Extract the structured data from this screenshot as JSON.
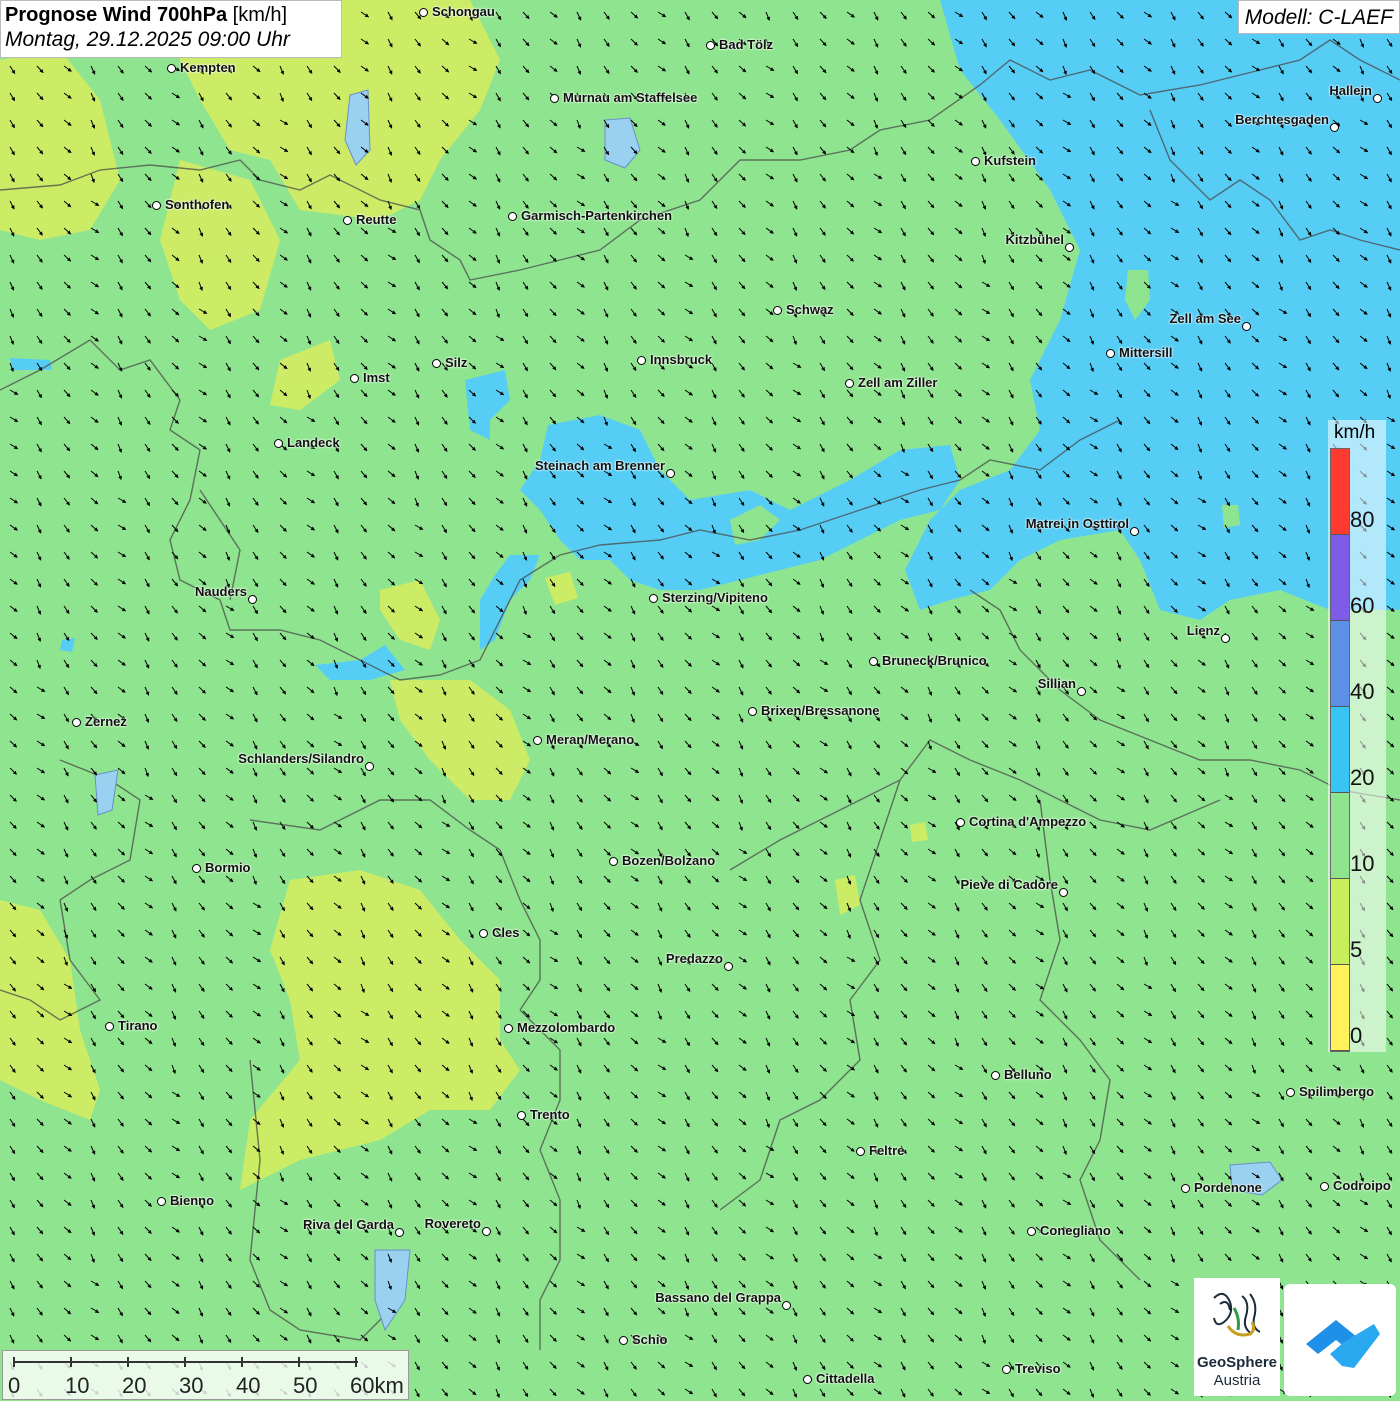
{
  "header": {
    "title_bold": "Prognose Wind 700hPa",
    "title_unit": "[km/h]",
    "datetime": "Montag, 29.12.2025 09:00 Uhr",
    "model": "Modell: C-LAEF"
  },
  "legend": {
    "unit": "km/h",
    "labels": [
      "80",
      "60",
      "40",
      "20",
      "10",
      "5",
      "0"
    ],
    "colors": [
      "#ff3b30",
      "#7f5ce8",
      "#5b8fe8",
      "#38c4f5",
      "#8fe58f",
      "#c8ee5a",
      "#fff25a"
    ]
  },
  "scale": {
    "labels": [
      "0",
      "10",
      "20",
      "30",
      "40",
      "50",
      "60km"
    ]
  },
  "colors": {
    "calm": "#d9ef5c",
    "light": "#8fe58f",
    "moderate": "#56d0f5",
    "borders": "#555555"
  },
  "wind": {
    "direction": "northwest",
    "arrow_color": "#000000"
  },
  "cities": [
    {
      "name": "Schongau"
    },
    {
      "name": "Bad Tölz"
    },
    {
      "name": "Kempten"
    },
    {
      "name": "Murnau am Staffelsee"
    },
    {
      "name": "Hallein"
    },
    {
      "name": "Berchtesgaden"
    },
    {
      "name": "Kufstein"
    },
    {
      "name": "Sonthofen"
    },
    {
      "name": "Reutte"
    },
    {
      "name": "Garmisch-Partenkirchen"
    },
    {
      "name": "Kitzbühel"
    },
    {
      "name": "Schwaz"
    },
    {
      "name": "Zell am See"
    },
    {
      "name": "Mittersill"
    },
    {
      "name": "Silz"
    },
    {
      "name": "Innsbruck"
    },
    {
      "name": "Imst"
    },
    {
      "name": "Zell am Ziller"
    },
    {
      "name": "Landeck"
    },
    {
      "name": "Steinach am Brenner"
    },
    {
      "name": "Matrei in Osttirol"
    },
    {
      "name": "Nauders"
    },
    {
      "name": "Sterzing/Vipiteno"
    },
    {
      "name": "Lienz"
    },
    {
      "name": "Bruneck/Brunico"
    },
    {
      "name": "Sillian"
    },
    {
      "name": "Zernez"
    },
    {
      "name": "Brixen/Bressanone"
    },
    {
      "name": "Meran/Merano"
    },
    {
      "name": "Schlanders/Silandro"
    },
    {
      "name": "Cortina d'Ampezzo"
    },
    {
      "name": "Bormio"
    },
    {
      "name": "Bozen/Bolzano"
    },
    {
      "name": "Pieve di Cadore"
    },
    {
      "name": "Cles"
    },
    {
      "name": "Predazzo"
    },
    {
      "name": "Tirano"
    },
    {
      "name": "Mezzolombardo"
    },
    {
      "name": "Belluno"
    },
    {
      "name": "Spilimbergo"
    },
    {
      "name": "Trento"
    },
    {
      "name": "Feltre"
    },
    {
      "name": "Pordenone"
    },
    {
      "name": "Codroipo"
    },
    {
      "name": "Bienno"
    },
    {
      "name": "Riva del Garda"
    },
    {
      "name": "Rovereto"
    },
    {
      "name": "Conegliano"
    },
    {
      "name": "Bassano del Grappa"
    },
    {
      "name": "Schio"
    },
    {
      "name": "Treviso"
    },
    {
      "name": "Cittadella"
    }
  ],
  "logos": {
    "geosphere_line1": "GeoSphere",
    "geosphere_line2": "Austria"
  }
}
